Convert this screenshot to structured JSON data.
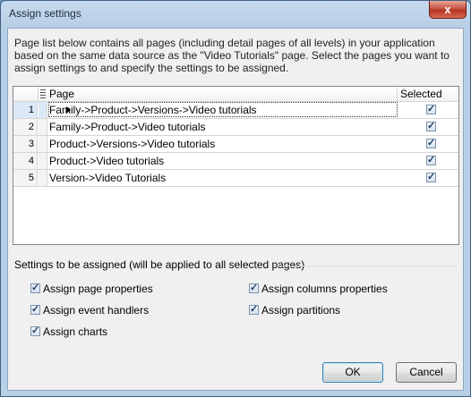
{
  "window": {
    "title": "Assign settings",
    "close_label": "x"
  },
  "description": "Page list below contains all pages (including detail pages of all levels) in your application based on the same data source as the \"Video Tutorials\" page. Select the pages you want to assign settings to and specify the settings to be assigned.",
  "grid": {
    "col_page": "Page",
    "col_selected": "Selected",
    "rows": [
      {
        "num": "1",
        "page": "Family->Product->Versions->Video tutorials",
        "selected": true,
        "active": true
      },
      {
        "num": "2",
        "page": "Family->Product->Video tutorials",
        "selected": true
      },
      {
        "num": "3",
        "page": "Product->Versions->Video tutorials",
        "selected": true
      },
      {
        "num": "4",
        "page": "Product->Video tutorials",
        "selected": true
      },
      {
        "num": "5",
        "page": "Version->Video Tutorials",
        "selected": true
      }
    ]
  },
  "settings": {
    "group_label": "Settings to be assigned (will be applied to all selected pages)",
    "options": [
      {
        "label": "Assign page properties",
        "checked": true
      },
      {
        "label": "Assign columns properties",
        "checked": true
      },
      {
        "label": "Assign event handlers",
        "checked": true
      },
      {
        "label": "Assign partitions",
        "checked": true
      },
      {
        "label": "Assign charts",
        "checked": true
      }
    ]
  },
  "buttons": {
    "ok": "OK",
    "cancel": "Cancel"
  }
}
